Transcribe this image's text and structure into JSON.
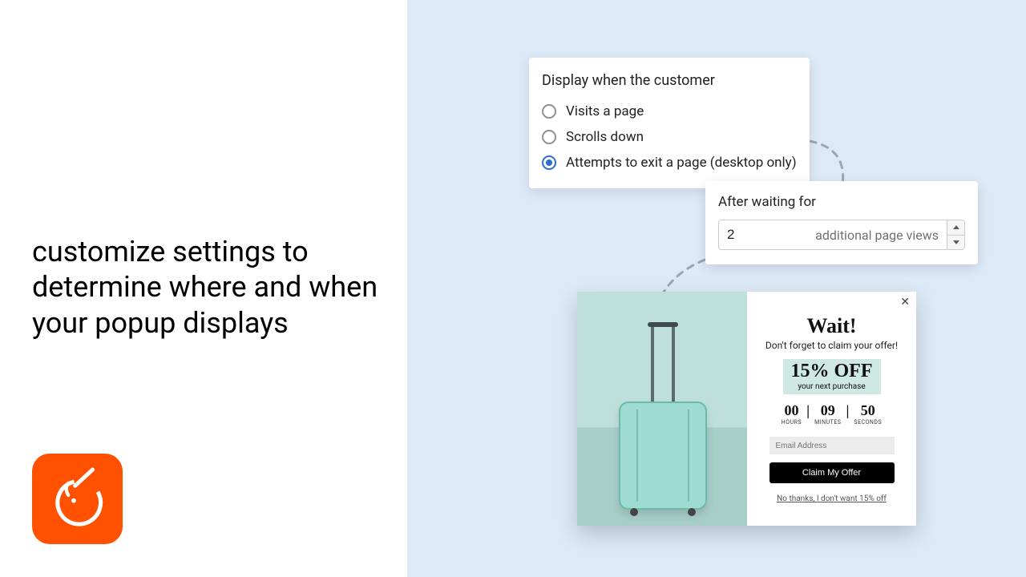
{
  "headline": "customize settings to determine where and when your popup displays",
  "trigger_card": {
    "title": "Display when the customer",
    "options": [
      {
        "label": "Visits a page",
        "selected": false
      },
      {
        "label": "Scrolls down",
        "selected": false
      },
      {
        "label": "Attempts to exit a page (desktop only)",
        "selected": true
      }
    ]
  },
  "delay_card": {
    "title": "After waiting for",
    "value": "2",
    "suffix": "additional page views"
  },
  "popup": {
    "heading": "Wait!",
    "subheading": "Don't forget to claim your offer!",
    "offer_main": "15% OFF",
    "offer_sub": "your next purchase",
    "timer": {
      "hours": "00",
      "hours_label": "HOURS",
      "minutes": "09",
      "minutes_label": "MINUTES",
      "seconds": "50",
      "seconds_label": "SECONDS",
      "sep": "|"
    },
    "email_placeholder": "Email Address",
    "cta": "Claim My Offer",
    "decline": "No thanks, I don't want 15% off"
  },
  "logo": {
    "color": "#ff5100"
  }
}
